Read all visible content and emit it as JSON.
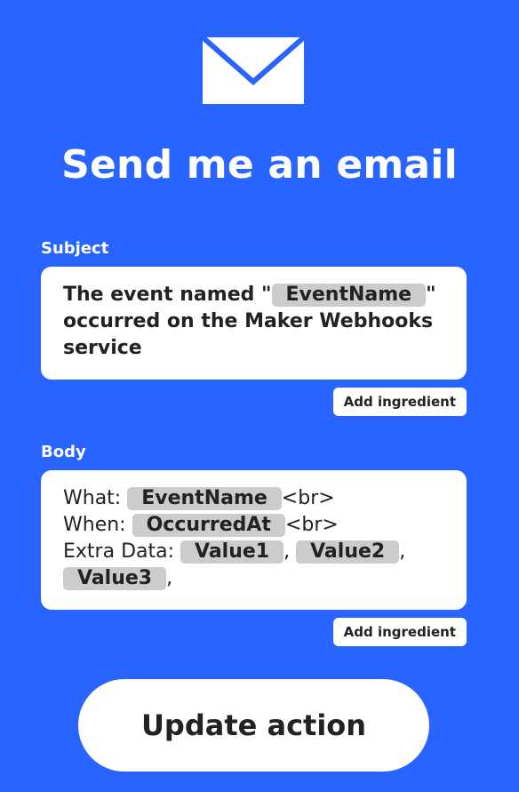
{
  "header": {
    "icon": "envelope-icon",
    "title": "Send me an email"
  },
  "subject": {
    "label": "Subject",
    "text_before": "The event named \"",
    "ingredient": "EventName",
    "text_after": "\" occurred on the Maker Webhooks service",
    "add_ingredient_label": "Add ingredient"
  },
  "body": {
    "label": "Body",
    "what_label": "What: ",
    "what_ingredient": "EventName",
    "br1": "<br>",
    "when_label": "When: ",
    "when_ingredient": "OccurredAt",
    "br2": "<br>",
    "extra_label": "Extra Data: ",
    "value1": "Value1",
    "sep1": ",",
    "value2": "Value2",
    "sep2": ",",
    "value3": "Value3",
    "sep3": ",",
    "add_ingredient_label": "Add ingredient"
  },
  "actions": {
    "update_label": "Update action"
  },
  "colors": {
    "background": "#2a64ff",
    "surface": "#ffffff",
    "pill": "#cccccc",
    "text": "#222222"
  }
}
